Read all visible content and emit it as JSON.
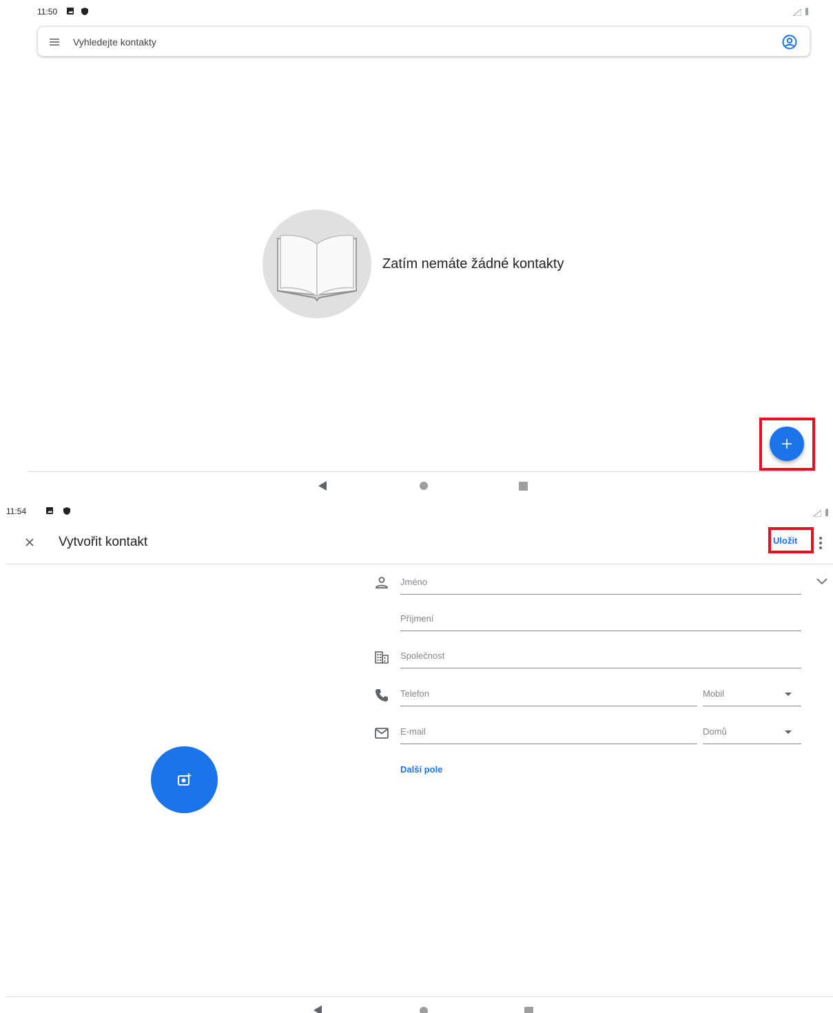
{
  "screen1": {
    "status": {
      "time": "11:50"
    },
    "search": {
      "placeholder": "Vyhledejte kontakty"
    },
    "empty_state": {
      "message": "Zatím nemáte žádné kontakty"
    },
    "icons": {
      "menu": "menu-icon",
      "account": "account-circle-icon",
      "add": "plus-icon",
      "illustration": "open-book-icon"
    }
  },
  "screen2": {
    "status": {
      "time": "11:54"
    },
    "toolbar": {
      "title": "Vytvořit kontakt",
      "save_label": "Uložit"
    },
    "form": {
      "first_name": "Jméno",
      "last_name": "Příjmení",
      "company": "Společnost",
      "phone": "Telefon",
      "phone_type": "Mobil",
      "email": "E-mail",
      "email_type": "Domů",
      "more_fields": "Další pole"
    }
  },
  "colors": {
    "accent": "#1a73e8",
    "highlight": "#e3101e"
  }
}
